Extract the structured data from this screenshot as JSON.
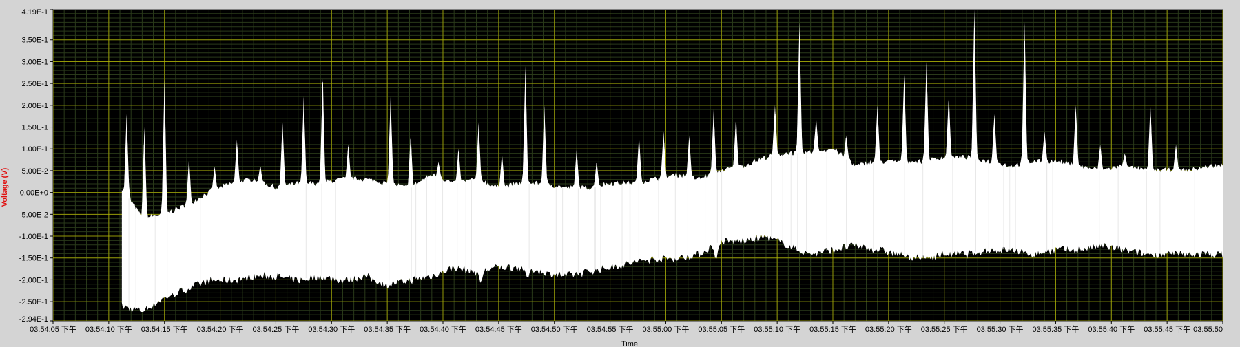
{
  "colors": {
    "background": "#d4d4d4",
    "plot_background": "#000000",
    "major_grid": "#b8b800",
    "minor_grid": "#2a3a1a",
    "signal": "#ffffff",
    "ylabel_color": "#e01010"
  },
  "chart_data": {
    "type": "line",
    "title": "",
    "xlabel": "Time",
    "ylabel": "Voltage (V)",
    "ylim": [
      -0.294,
      0.419
    ],
    "xlim": [
      "03:54:05",
      "03:55:50"
    ],
    "grid": true,
    "y_ticks": [
      "4.19E-1",
      "3.50E-1",
      "3.00E-1",
      "2.50E-1",
      "2.00E-1",
      "1.50E-1",
      "1.00E-1",
      "5.00E-2",
      "0.00E+0",
      "-5.00E-2",
      "-1.00E-1",
      "-1.50E-1",
      "-2.00E-1",
      "-2.50E-1",
      "-2.94E-1"
    ],
    "y_tick_values": [
      0.419,
      0.35,
      0.3,
      0.25,
      0.2,
      0.15,
      0.1,
      0.05,
      0.0,
      -0.05,
      -0.1,
      -0.15,
      -0.2,
      -0.25,
      -0.294
    ],
    "x_ticks": [
      "03:54:05 下午",
      "03:54:10 下午",
      "03:54:15 下午",
      "03:54:20 下午",
      "03:54:25 下午",
      "03:54:30 下午",
      "03:54:35 下午",
      "03:54:40 下午",
      "03:54:45 下午",
      "03:54:50 下午",
      "03:54:55 下午",
      "03:55:00 下午",
      "03:55:05 下午",
      "03:55:10 下午",
      "03:55:15 下午",
      "03:55:20 下午",
      "03:55:25 下午",
      "03:55:30 下午",
      "03:55:35 下午",
      "03:55:40 下午",
      "03:55:45 下午",
      "03:55:50"
    ],
    "x_tick_seconds": [
      0,
      5,
      10,
      15,
      20,
      25,
      30,
      35,
      40,
      45,
      50,
      55,
      60,
      65,
      70,
      75,
      80,
      85,
      90,
      95,
      100,
      105
    ],
    "series": [
      {
        "x_seconds": [
          6.2,
          8,
          10,
          12,
          14,
          16,
          18,
          20,
          22,
          24,
          26,
          28,
          30,
          32,
          34,
          36,
          38,
          40,
          42,
          44,
          46,
          48,
          50,
          52,
          54,
          56,
          58,
          60,
          62,
          64,
          66,
          68,
          70,
          72,
          74,
          76,
          78,
          80,
          82,
          84,
          86,
          88,
          90,
          92,
          94,
          96,
          98,
          100,
          102,
          104,
          105
        ],
        "upper": [
          0.01,
          -0.06,
          -0.05,
          -0.03,
          0.0,
          0.02,
          0.03,
          0.01,
          0.02,
          0.02,
          0.03,
          0.03,
          0.02,
          0.01,
          0.04,
          0.02,
          0.03,
          0.01,
          0.02,
          0.02,
          0.01,
          0.01,
          0.02,
          0.02,
          0.03,
          0.04,
          0.03,
          0.05,
          0.06,
          0.08,
          0.09,
          0.09,
          0.1,
          0.06,
          0.07,
          0.07,
          0.07,
          0.08,
          0.08,
          0.07,
          0.06,
          0.07,
          0.07,
          0.06,
          0.05,
          0.06,
          0.05,
          0.05,
          0.05,
          0.06,
          0.06
        ],
        "lower": [
          -0.26,
          -0.27,
          -0.24,
          -0.22,
          -0.2,
          -0.2,
          -0.19,
          -0.19,
          -0.2,
          -0.19,
          -0.2,
          -0.19,
          -0.21,
          -0.2,
          -0.19,
          -0.17,
          -0.18,
          -0.17,
          -0.17,
          -0.18,
          -0.19,
          -0.18,
          -0.17,
          -0.16,
          -0.15,
          -0.15,
          -0.14,
          -0.11,
          -0.11,
          -0.1,
          -0.12,
          -0.14,
          -0.13,
          -0.12,
          -0.13,
          -0.14,
          -0.15,
          -0.14,
          -0.14,
          -0.13,
          -0.13,
          -0.14,
          -0.13,
          -0.13,
          -0.12,
          -0.13,
          -0.14,
          -0.14,
          -0.14,
          -0.14,
          -0.14
        ]
      }
    ],
    "spikes": [
      {
        "x": 6.6,
        "y": 0.18
      },
      {
        "x": 8.2,
        "y": 0.15
      },
      {
        "x": 10.0,
        "y": 0.26
      },
      {
        "x": 12.2,
        "y": 0.08
      },
      {
        "x": 14.5,
        "y": 0.06
      },
      {
        "x": 16.5,
        "y": 0.12
      },
      {
        "x": 18.6,
        "y": 0.06
      },
      {
        "x": 20.6,
        "y": 0.16
      },
      {
        "x": 22.5,
        "y": 0.22
      },
      {
        "x": 24.2,
        "y": 0.26
      },
      {
        "x": 26.5,
        "y": 0.11
      },
      {
        "x": 30.3,
        "y": 0.22
      },
      {
        "x": 32.1,
        "y": 0.13
      },
      {
        "x": 34.6,
        "y": 0.07
      },
      {
        "x": 36.4,
        "y": 0.1
      },
      {
        "x": 38.2,
        "y": 0.16
      },
      {
        "x": 40.3,
        "y": 0.09
      },
      {
        "x": 42.4,
        "y": 0.29
      },
      {
        "x": 44.1,
        "y": 0.2
      },
      {
        "x": 47.0,
        "y": 0.1
      },
      {
        "x": 48.8,
        "y": 0.07
      },
      {
        "x": 52.6,
        "y": 0.13
      },
      {
        "x": 54.8,
        "y": 0.14
      },
      {
        "x": 57.1,
        "y": 0.13
      },
      {
        "x": 59.3,
        "y": 0.19
      },
      {
        "x": 61.3,
        "y": 0.17
      },
      {
        "x": 64.8,
        "y": 0.2
      },
      {
        "x": 67.0,
        "y": 0.39
      },
      {
        "x": 68.5,
        "y": 0.17
      },
      {
        "x": 71.2,
        "y": 0.13
      },
      {
        "x": 74.0,
        "y": 0.2
      },
      {
        "x": 76.4,
        "y": 0.27
      },
      {
        "x": 78.4,
        "y": 0.3
      },
      {
        "x": 80.4,
        "y": 0.22
      },
      {
        "x": 82.7,
        "y": 0.42
      },
      {
        "x": 84.5,
        "y": 0.18
      },
      {
        "x": 87.2,
        "y": 0.39
      },
      {
        "x": 89.0,
        "y": 0.14
      },
      {
        "x": 91.8,
        "y": 0.2
      },
      {
        "x": 94.0,
        "y": 0.11
      },
      {
        "x": 96.2,
        "y": 0.09
      },
      {
        "x": 98.5,
        "y": 0.2
      },
      {
        "x": 100.8,
        "y": 0.11
      }
    ],
    "dips": [
      {
        "x": 6.4,
        "y": -0.2
      },
      {
        "x": 8.6,
        "y": -0.2
      },
      {
        "x": 10.3,
        "y": -0.2
      },
      {
        "x": 16.8,
        "y": -0.18
      },
      {
        "x": 20.8,
        "y": -0.19
      },
      {
        "x": 22.7,
        "y": -0.2
      },
      {
        "x": 24.4,
        "y": -0.19
      },
      {
        "x": 30.5,
        "y": -0.2
      },
      {
        "x": 38.4,
        "y": -0.21
      },
      {
        "x": 42.6,
        "y": -0.2
      },
      {
        "x": 44.3,
        "y": -0.18
      },
      {
        "x": 59.5,
        "y": -0.16
      },
      {
        "x": 67.2,
        "y": -0.14
      },
      {
        "x": 76.6,
        "y": -0.14
      },
      {
        "x": 82.9,
        "y": -0.14
      },
      {
        "x": 87.4,
        "y": -0.13
      }
    ]
  }
}
